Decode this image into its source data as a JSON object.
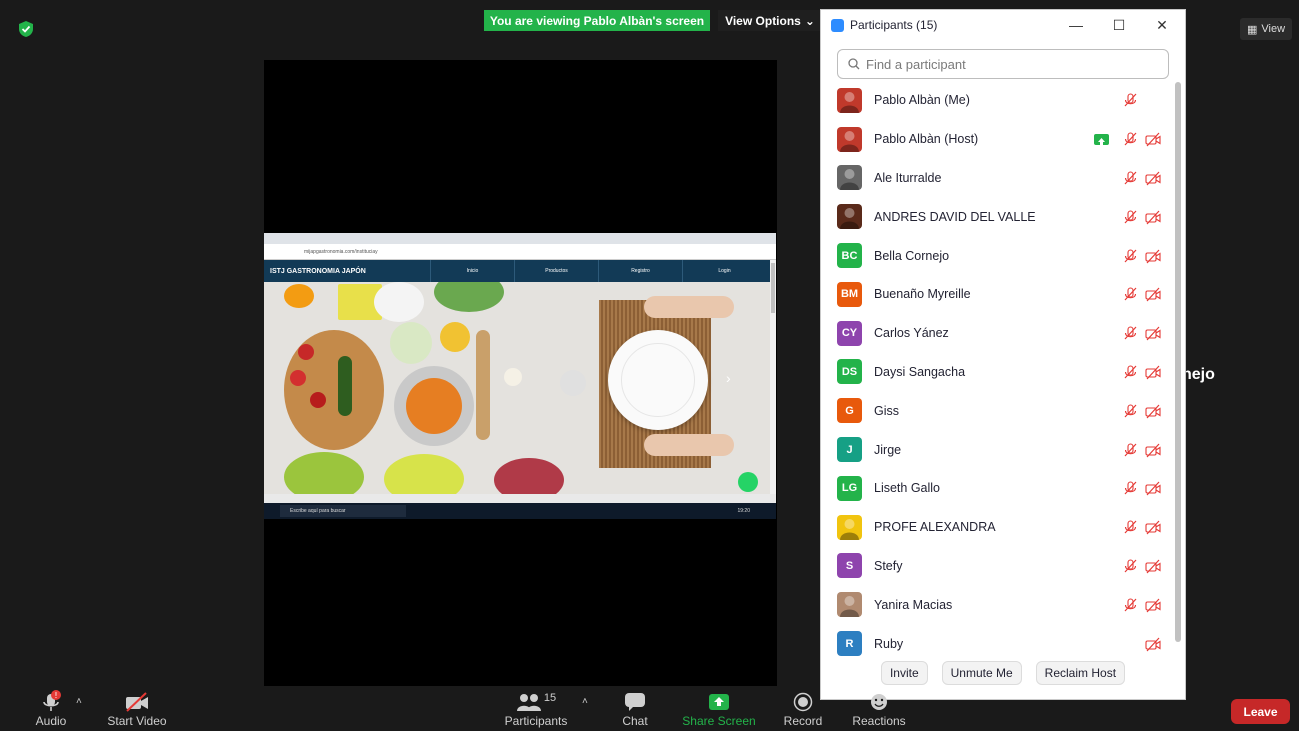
{
  "banner": {
    "viewing": "You are viewing Pablo Albàn's screen",
    "view_options": "View Options"
  },
  "view_button": {
    "label": "View"
  },
  "side_name": "nejo",
  "shared_screen": {
    "url": "mijapgastronomia.com/instituciay",
    "site_brand": "ISTJ GASTRONOMIA  JAPÓN",
    "nav_links": [
      "Inicio",
      "Productos",
      "Registro",
      "Login"
    ],
    "taskbar_search": "Escribe aquí para buscar",
    "clock": "19:20"
  },
  "panel": {
    "title": "Participants (15)",
    "search_placeholder": "Find a participant",
    "participants": [
      {
        "name": "Pablo Albàn (Me)",
        "initials": "",
        "color": "#c0392b",
        "photo": "red",
        "mic": true,
        "video": false,
        "sharing": false
      },
      {
        "name": "Pablo Albàn (Host)",
        "initials": "",
        "color": "#c0392b",
        "photo": "red",
        "mic": true,
        "video": true,
        "sharing": true
      },
      {
        "name": "Ale Iturralde",
        "initials": "",
        "color": "#666666",
        "photo": "gray",
        "mic": true,
        "video": true,
        "sharing": false
      },
      {
        "name": "ANDRES DAVID DEL VALLE",
        "initials": "",
        "color": "#5a2a1a",
        "photo": "dark",
        "mic": true,
        "video": true,
        "sharing": false
      },
      {
        "name": "Bella Cornejo",
        "initials": "BC",
        "color": "#23b34a",
        "mic": true,
        "video": true,
        "sharing": false
      },
      {
        "name": "Buenaño Myreille",
        "initials": "BM",
        "color": "#e8590c",
        "mic": true,
        "video": true,
        "sharing": false
      },
      {
        "name": "Carlos Yánez",
        "initials": "CY",
        "color": "#8e44ad",
        "mic": true,
        "video": true,
        "sharing": false
      },
      {
        "name": "Daysi Sangacha",
        "initials": "DS",
        "color": "#23b34a",
        "mic": true,
        "video": true,
        "sharing": false
      },
      {
        "name": "Giss",
        "initials": "G",
        "color": "#e8590c",
        "mic": true,
        "video": true,
        "sharing": false
      },
      {
        "name": "Jirge",
        "initials": "J",
        "color": "#16a085",
        "mic": true,
        "video": true,
        "sharing": false
      },
      {
        "name": "Liseth Gallo",
        "initials": "LG",
        "color": "#23b34a",
        "mic": true,
        "video": true,
        "sharing": false
      },
      {
        "name": "PROFE ALEXANDRA",
        "initials": "",
        "color": "#f1c40f",
        "photo": "yellow",
        "mic": true,
        "video": true,
        "sharing": false
      },
      {
        "name": "Stefy",
        "initials": "S",
        "color": "#8e44ad",
        "mic": true,
        "video": true,
        "sharing": false
      },
      {
        "name": "Yanira Macias",
        "initials": "",
        "color": "#b08a70",
        "photo": "tan",
        "mic": true,
        "video": true,
        "sharing": false
      },
      {
        "name": "Ruby",
        "initials": "R",
        "color": "#2d7fc1",
        "mic": false,
        "video": true,
        "sharing": false
      }
    ],
    "footer": {
      "invite": "Invite",
      "unmute_me": "Unmute Me",
      "reclaim_host": "Reclaim Host"
    }
  },
  "toolbar": {
    "audio": "Audio",
    "start_video": "Start Video",
    "participants": "Participants",
    "participant_count": "15",
    "chat": "Chat",
    "share_screen": "Share Screen",
    "record": "Record",
    "reactions": "Reactions",
    "leave": "Leave",
    "audio_alert": "!"
  }
}
